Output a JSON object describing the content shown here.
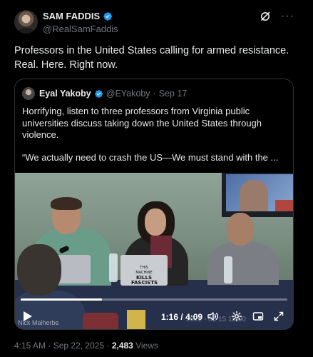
{
  "author": {
    "display_name": "SAM FADDIS",
    "handle": "@RealSamFaddis"
  },
  "post": {
    "text": "Professors in the United States calling for armed resistance. Real. Here. Right now."
  },
  "quoted_post": {
    "display_name": "Eyal Yakoby",
    "handle": "@EYakoby",
    "date": "Sep 17",
    "separator": "·",
    "text": "Horrifying, listen to three professors from Virginia public universities discuss taking down the United States through violence.",
    "quote_line": "“We actually need to crash the US—We must stand with the ..."
  },
  "video": {
    "current_time": "1:16",
    "duration": "4:09",
    "time_separator": "/",
    "progress_fraction": 0.305,
    "watermark": "Nick Malherbe",
    "recording_timestamp": "2022 - 03 15 15:00",
    "laptop_sticker_top": "THIS MACHINE",
    "laptop_sticker_bottom": "KILLS FASCISTS"
  },
  "footer": {
    "time": "4:15 AM",
    "date": "Sep 22, 2025",
    "separator": "·",
    "views_count": "2,483",
    "views_label": "Views"
  },
  "icons": {
    "verified": "verified-badge-icon",
    "grok": "grok-icon",
    "more": "more-icon",
    "play": "play-icon",
    "volume": "volume-icon",
    "settings": "settings-icon",
    "pip": "picture-in-picture-icon",
    "expand": "expand-icon"
  },
  "colors": {
    "background": "#000000",
    "text": "#e7e9ea",
    "secondary_text": "#71767b",
    "verified_blue": "#1d9bf0",
    "border": "#2f3336"
  }
}
